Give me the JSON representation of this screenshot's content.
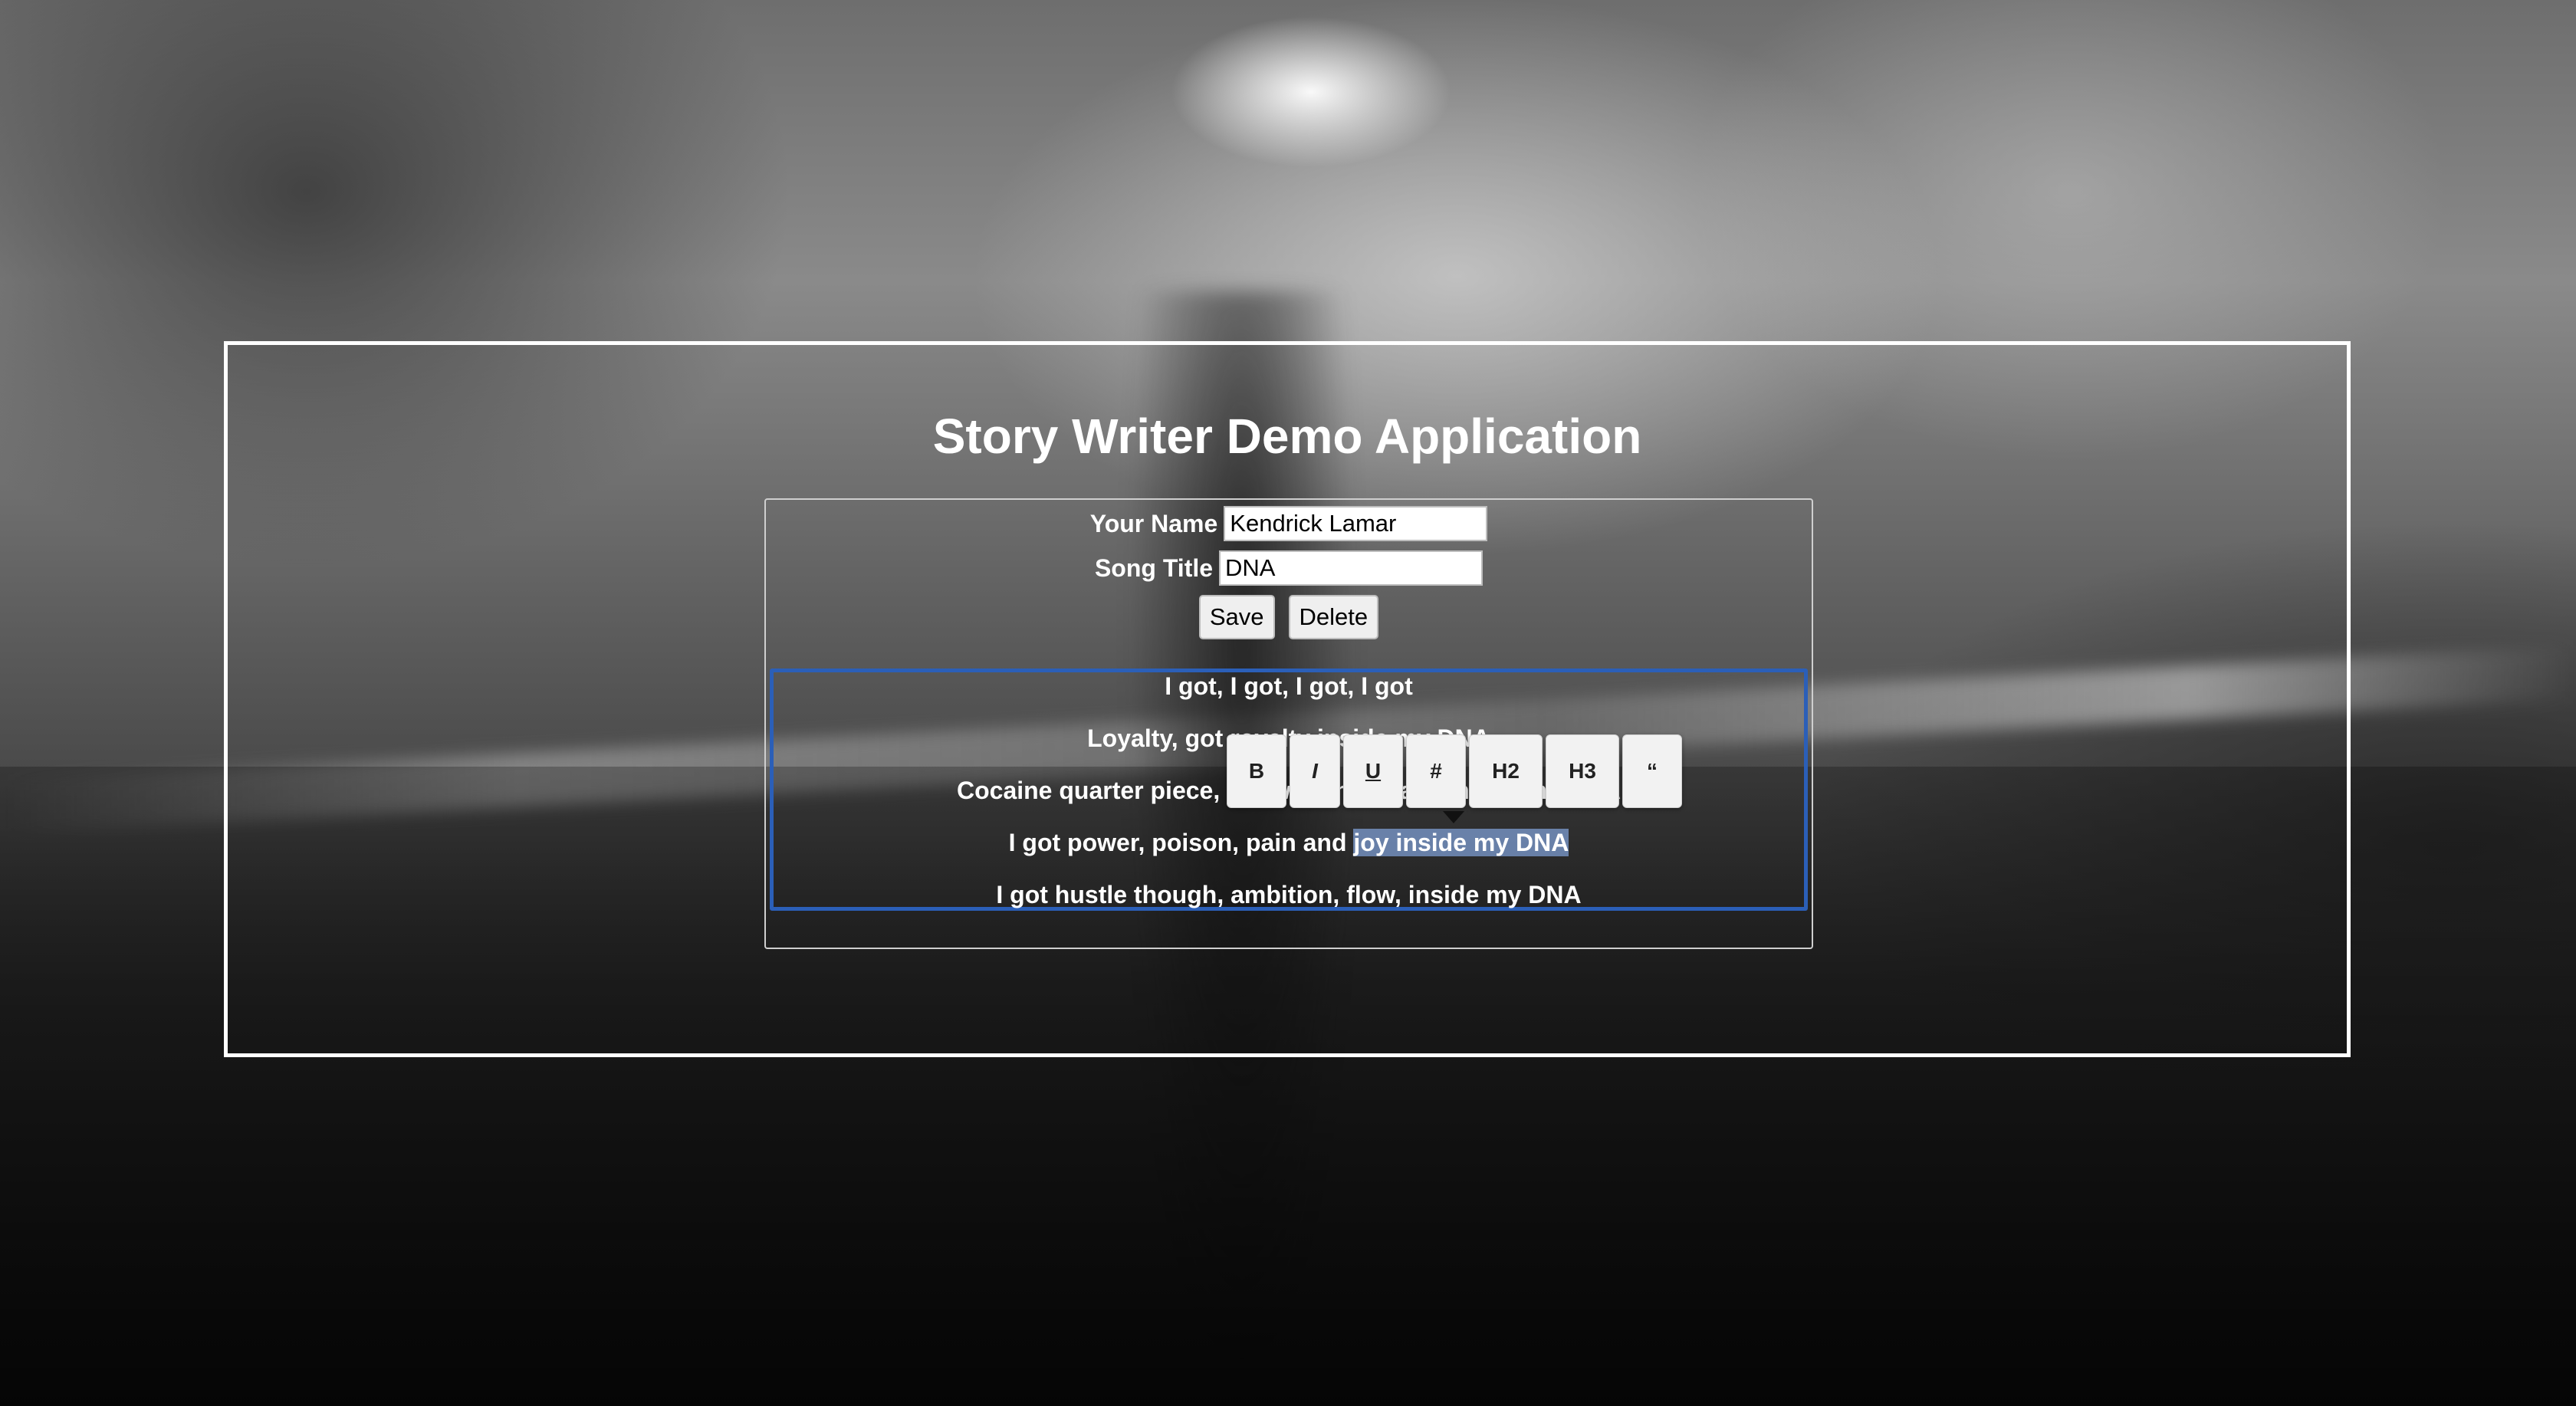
{
  "app": {
    "title": "Story Writer Demo Application"
  },
  "form": {
    "name_label": "Your Name",
    "name_value": "Kendrick Lamar",
    "title_label": "Song Title",
    "title_value": "DNA",
    "save_label": "Save",
    "delete_label": "Delete"
  },
  "editor": {
    "lines": [
      {
        "text": "I got, I got, I got, I got"
      },
      {
        "text": "Loyalty, got royalty inside my DNA"
      },
      {
        "text": "Cocaine quarter piece, got war and peace inside my DNA"
      },
      {
        "before": "I got power, poison, pain and ",
        "selected": "joy inside my DNA"
      },
      {
        "text": "I got hustle though, ambition, flow, inside my DNA"
      }
    ],
    "selection_color": "#7896c8",
    "border_color": "#2b5fb8"
  },
  "toolbar": {
    "buttons": [
      {
        "label": "B",
        "icon": "bold-icon"
      },
      {
        "label": "I",
        "icon": "italic-icon"
      },
      {
        "label": "U",
        "icon": "underline-icon"
      },
      {
        "label": "#",
        "icon": "h1-icon"
      },
      {
        "label": "H2",
        "icon": "h2-icon"
      },
      {
        "label": "H3",
        "icon": "h3-icon"
      },
      {
        "label": "“",
        "icon": "quote-icon"
      }
    ]
  }
}
